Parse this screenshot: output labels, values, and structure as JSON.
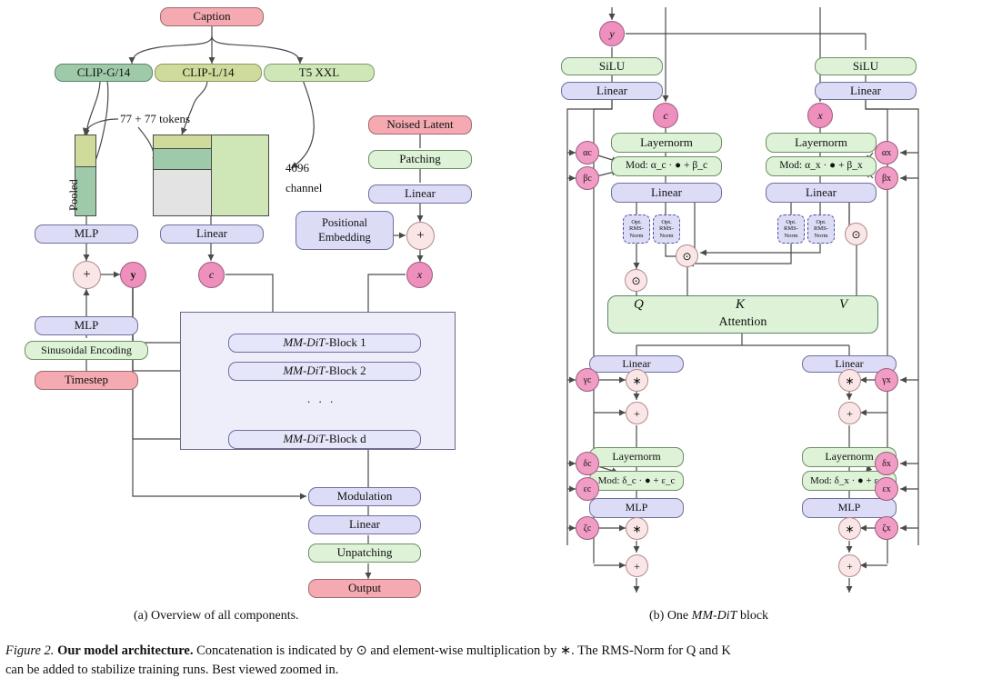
{
  "figure": {
    "number": "Figure 2.",
    "bold_title": "Our model architecture.",
    "caption_line1": " Concatenation is indicated by ⊙ and element-wise multiplication by ∗. The RMS-Norm for Q and K",
    "caption_line2": "can be added to stabilize training runs. Best viewed zoomed in."
  },
  "subcaptions": {
    "a": "(a) Overview of all components.",
    "b_prefix": "(b) One ",
    "b_italic": "MM-DiT",
    "b_suffix": " block"
  },
  "panel_a": {
    "caption_box": "Caption",
    "encoders": [
      {
        "label": "CLIP-G/14"
      },
      {
        "label": "CLIP-L/14"
      },
      {
        "label": "T5 XXL"
      }
    ],
    "pooled_label": "Pooled",
    "tokens_label": "77 + 77 tokens",
    "channel_label_line1": "4096",
    "channel_label_line2": "channel",
    "noised_latent": "Noised Latent",
    "patching": "Patching",
    "latent_linear": "Linear",
    "positional_embedding_line1": "Positional",
    "positional_embedding_line2": "Embedding",
    "text_mlp": "MLP",
    "cond_linear": "Linear",
    "time_mlp": "MLP",
    "sinusoidal": "Sinusoidal Encoding",
    "timestep": "Timestep",
    "var_y": "y",
    "var_c": "c",
    "var_x": "x",
    "plus": "+",
    "blocks": [
      {
        "italic": "MM-DiT",
        "rest": "-Block 1"
      },
      {
        "italic": "MM-DiT",
        "rest": "-Block 2"
      },
      {
        "italic": "MM-DiT",
        "rest": "-Block d"
      }
    ],
    "ellipsis": ". . .",
    "modulation": "Modulation",
    "out_linear": "Linear",
    "unpatching": "Unpatching",
    "output": "Output"
  },
  "panel_b": {
    "var_y": "y",
    "var_c": "c",
    "var_x": "x",
    "silu": "SiLU",
    "linear": "Linear",
    "layernorm": "Layernorm",
    "mlp": "MLP",
    "mod_c_attn": "Mod: α_c · ● + β_c",
    "mod_x_attn": "Mod: α_x · ● + β_x",
    "mod_c_mlp": "Mod: δ_c · ● + ε_c",
    "mod_x_mlp": "Mod: δ_x · ● + ε_x",
    "rms_line1": "Opt.",
    "rms_line2": "RMS-",
    "rms_line3": "Norm",
    "attention": "Attention",
    "q": "Q",
    "k": "K",
    "v": "V",
    "concat_symbol": "⊙",
    "mult_symbol": "∗",
    "plus_symbol": "+",
    "greek_c": [
      "αc",
      "βc",
      "γc",
      "δc",
      "εc",
      "ζc"
    ],
    "greek_x": [
      "αx",
      "βx",
      "γx",
      "δx",
      "εx",
      "ζx"
    ]
  },
  "colors": {
    "pink": "#f4aab0",
    "green": "#ddf2d6",
    "blue": "#dcdcf7",
    "magenta": "#ee8fbe",
    "op_circle": "#fae6e6",
    "stack_panel": "#eeeefb"
  }
}
